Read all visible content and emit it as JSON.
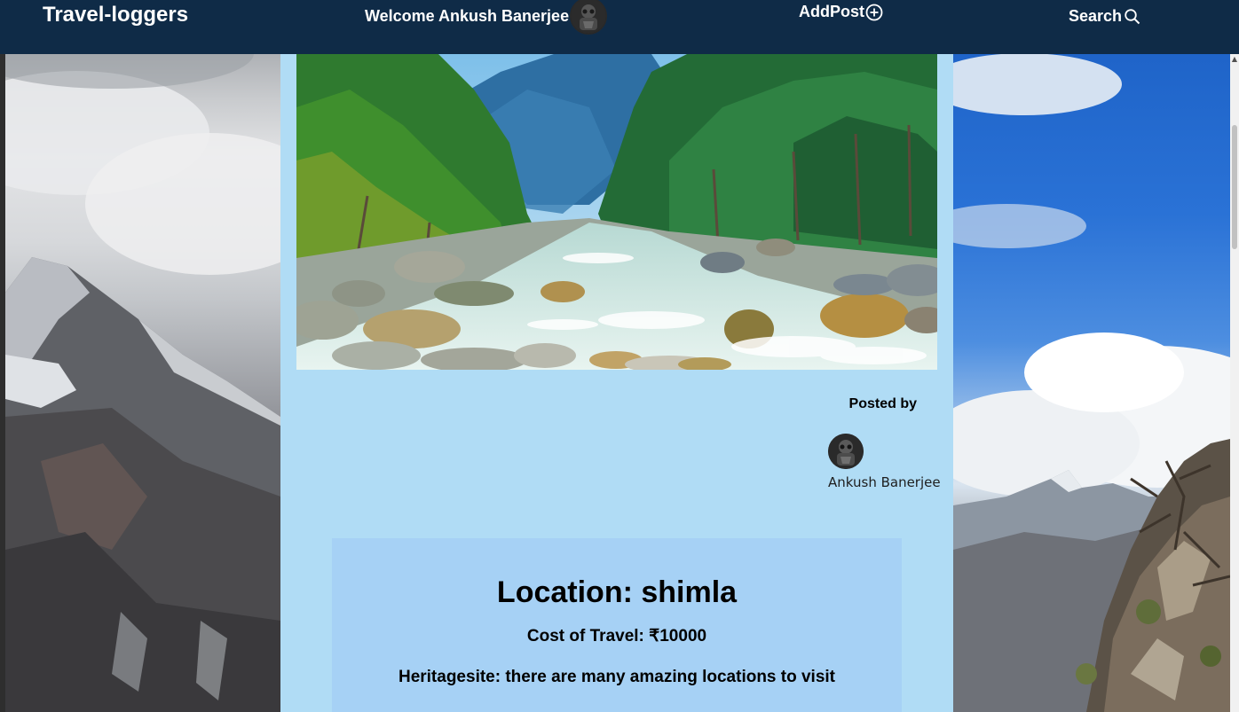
{
  "navbar": {
    "brand": "Travel-loggers",
    "welcome": "Welcome Ankush Banerjee",
    "add_post_label": "AddPost",
    "search_label": "Search",
    "icons": {
      "add": "plus-circle-icon",
      "search": "search-icon"
    }
  },
  "post": {
    "posted_by_label": "Posted by",
    "author_name": "Ankush Banerjee",
    "location_label": "Location: shimla",
    "cost_label": "Cost of Travel: ₹10000",
    "heritage_label": "Heritagesite: there are many amazing locations to visit"
  },
  "colors": {
    "navbar_bg": "#0f2b47",
    "content_bg": "#b0dcf5",
    "card_bg": "#a6d1f5",
    "text": "#000000"
  }
}
